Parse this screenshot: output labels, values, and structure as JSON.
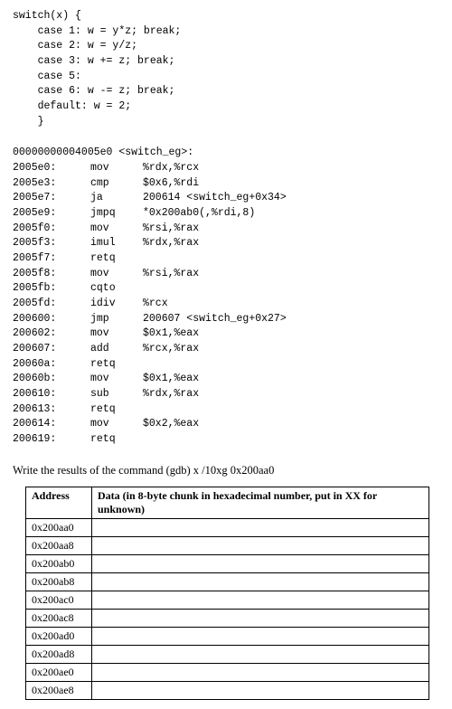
{
  "c_source": "switch(x) {\n    case 1: w = y*z; break;\n    case 2: w = y/z;\n    case 3: w += z; break;\n    case 5:\n    case 6: w -= z; break;\n    default: w = 2;\n    }",
  "asm": {
    "header": "00000000004005e0 <switch_eg>:",
    "rows": [
      {
        "addr": "2005e0:",
        "inst": "mov",
        "oper": "%rdx,%rcx"
      },
      {
        "addr": "2005e3:",
        "inst": "cmp",
        "oper": "$0x6,%rdi"
      },
      {
        "addr": "2005e7:",
        "inst": "ja",
        "oper": "200614 <switch_eg+0x34>"
      },
      {
        "addr": "2005e9:",
        "inst": "jmpq",
        "oper": "*0x200ab0(,%rdi,8)"
      },
      {
        "addr": "2005f0:",
        "inst": "mov",
        "oper": "%rsi,%rax"
      },
      {
        "addr": "2005f3:",
        "inst": "imul",
        "oper": "%rdx,%rax"
      },
      {
        "addr": "2005f7:",
        "inst": "retq",
        "oper": ""
      },
      {
        "addr": "2005f8:",
        "inst": "mov",
        "oper": "%rsi,%rax"
      },
      {
        "addr": "2005fb:",
        "inst": "cqto",
        "oper": ""
      },
      {
        "addr": "2005fd:",
        "inst": "idiv",
        "oper": "%rcx"
      },
      {
        "addr": "200600:",
        "inst": "jmp",
        "oper": "200607 <switch_eg+0x27>"
      },
      {
        "addr": "200602:",
        "inst": "mov",
        "oper": "$0x1,%eax"
      },
      {
        "addr": "200607:",
        "inst": "add",
        "oper": "%rcx,%rax"
      },
      {
        "addr": "20060a:",
        "inst": "retq",
        "oper": ""
      },
      {
        "addr": "20060b:",
        "inst": "mov",
        "oper": "$0x1,%eax"
      },
      {
        "addr": "200610:",
        "inst": "sub",
        "oper": "%rdx,%rax"
      },
      {
        "addr": "200613:",
        "inst": "retq",
        "oper": ""
      },
      {
        "addr": "200614:",
        "inst": "mov",
        "oper": "$0x2,%eax"
      },
      {
        "addr": "200619:",
        "inst": "retq",
        "oper": ""
      }
    ]
  },
  "question": "Write the results of the command (gdb)  x  /10xg 0x200aa0",
  "table": {
    "hdr_addr": "Address",
    "hdr_data": "Data (in 8-byte chunk in hexadecimal number, put in XX for unknown)",
    "rows": [
      {
        "addr": "0x200aa0",
        "data": ""
      },
      {
        "addr": "0x200aa8",
        "data": ""
      },
      {
        "addr": "0x200ab0",
        "data": ""
      },
      {
        "addr": "0x200ab8",
        "data": ""
      },
      {
        "addr": "0x200ac0",
        "data": ""
      },
      {
        "addr": "0x200ac8",
        "data": ""
      },
      {
        "addr": "0x200ad0",
        "data": ""
      },
      {
        "addr": "0x200ad8",
        "data": ""
      },
      {
        "addr": "0x200ae0",
        "data": ""
      },
      {
        "addr": "0x200ae8",
        "data": ""
      }
    ]
  }
}
